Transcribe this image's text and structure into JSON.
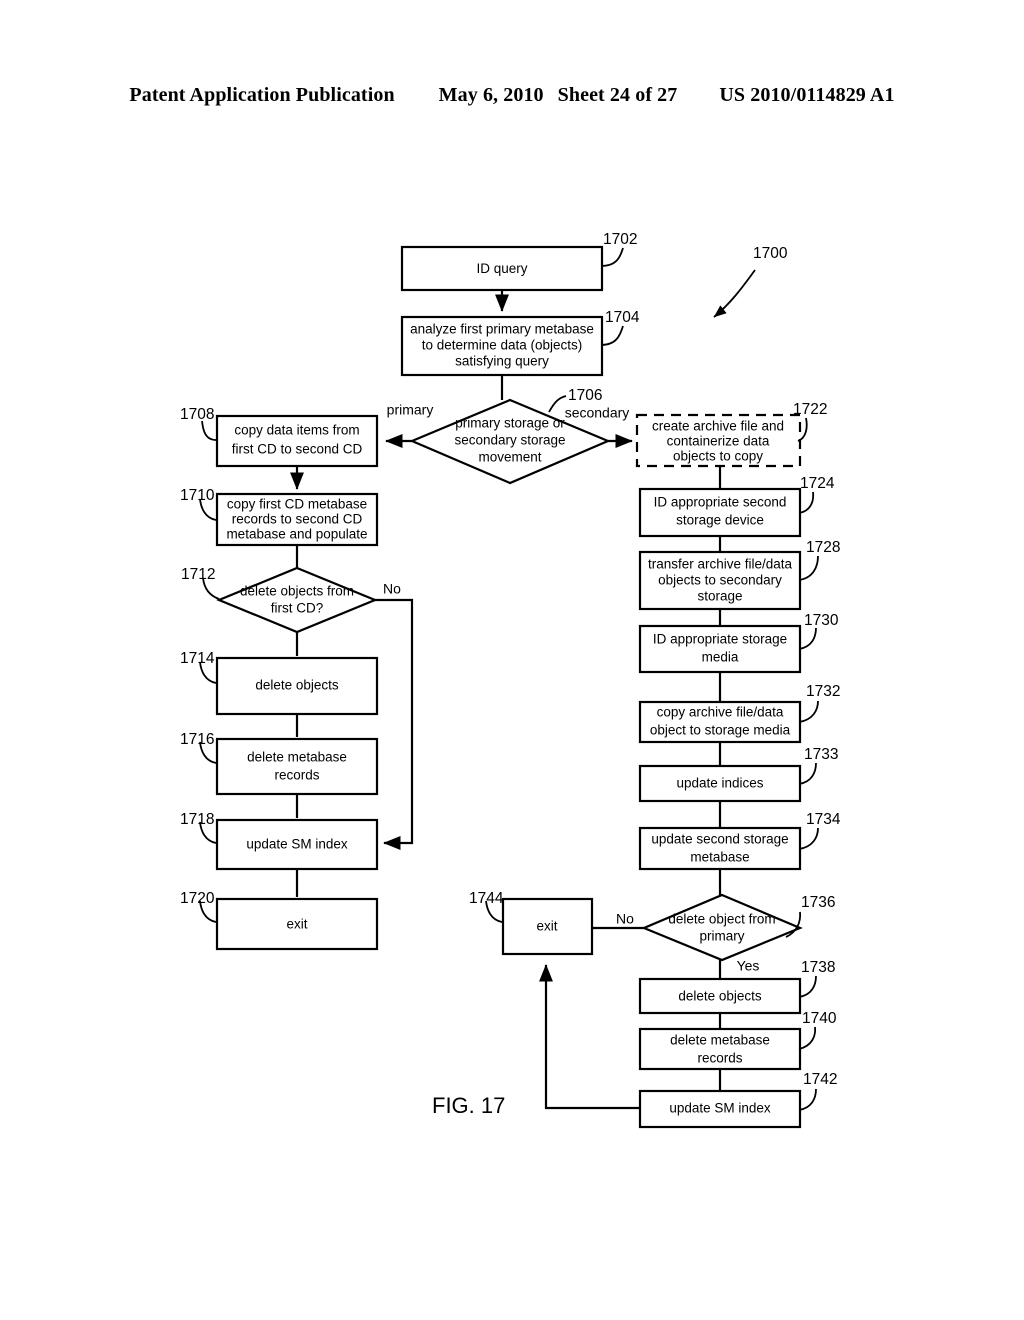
{
  "header": {
    "publication": "Patent Application Publication",
    "date": "May 6, 2010",
    "sheet": "Sheet 24 of 27",
    "patent_number": "US 2010/0114829 A1"
  },
  "figure": {
    "caption": "FIG. 17",
    "diagram_ref": "1700",
    "nodes": [
      {
        "ref": "1702",
        "shape": "box",
        "lines": [
          "ID query"
        ]
      },
      {
        "ref": "1704",
        "shape": "box",
        "lines": [
          "analyze first primary metabase",
          "to determine data (objects)",
          "satisfying query"
        ]
      },
      {
        "ref": "1706",
        "shape": "diamond",
        "lines": [
          "primary storage or",
          "secondary storage",
          "movement"
        ]
      },
      {
        "ref": "1708",
        "shape": "box",
        "lines": [
          "copy data items from",
          "first CD to second CD"
        ]
      },
      {
        "ref": "1710",
        "shape": "box",
        "lines": [
          "copy first CD metabase",
          "records to second CD",
          "metabase and populate"
        ]
      },
      {
        "ref": "1712",
        "shape": "diamond",
        "lines": [
          "delete objects from",
          "first CD?"
        ]
      },
      {
        "ref": "1714",
        "shape": "box",
        "lines": [
          "delete objects"
        ]
      },
      {
        "ref": "1716",
        "shape": "box",
        "lines": [
          "delete metabase",
          "records"
        ]
      },
      {
        "ref": "1718",
        "shape": "box",
        "lines": [
          "update SM index"
        ]
      },
      {
        "ref": "1720",
        "shape": "box",
        "lines": [
          "exit"
        ]
      },
      {
        "ref": "1722",
        "shape": "box-dashed",
        "lines": [
          "create archive file and",
          "containerize data",
          "objects to copy"
        ]
      },
      {
        "ref": "1724",
        "shape": "box",
        "lines": [
          "ID appropriate second",
          "storage device"
        ]
      },
      {
        "ref": "1728",
        "shape": "box",
        "lines": [
          "transfer archive file/data",
          "objects to secondary",
          "storage"
        ]
      },
      {
        "ref": "1730",
        "shape": "box",
        "lines": [
          "ID appropriate storage",
          "media"
        ]
      },
      {
        "ref": "1732",
        "shape": "box",
        "lines": [
          "copy archive file/data",
          "object to storage media"
        ]
      },
      {
        "ref": "1733",
        "shape": "box",
        "lines": [
          "update indices"
        ]
      },
      {
        "ref": "1734",
        "shape": "box",
        "lines": [
          "update second storage",
          "metabase"
        ]
      },
      {
        "ref": "1736",
        "shape": "diamond",
        "lines": [
          "delete object from",
          "primary"
        ]
      },
      {
        "ref": "1738",
        "shape": "box",
        "lines": [
          "delete objects"
        ]
      },
      {
        "ref": "1740",
        "shape": "box",
        "lines": [
          "delete metabase",
          "records"
        ]
      },
      {
        "ref": "1742",
        "shape": "box",
        "lines": [
          "update SM index"
        ]
      },
      {
        "ref": "1744",
        "shape": "box",
        "lines": [
          "exit"
        ]
      }
    ],
    "edge_labels": [
      {
        "id": "primary",
        "text": "primary"
      },
      {
        "id": "secondary",
        "text": "secondary"
      },
      {
        "id": "no_1712",
        "text": "No"
      },
      {
        "id": "no_1736",
        "text": "No"
      },
      {
        "id": "yes_1736",
        "text": "Yes"
      }
    ]
  }
}
